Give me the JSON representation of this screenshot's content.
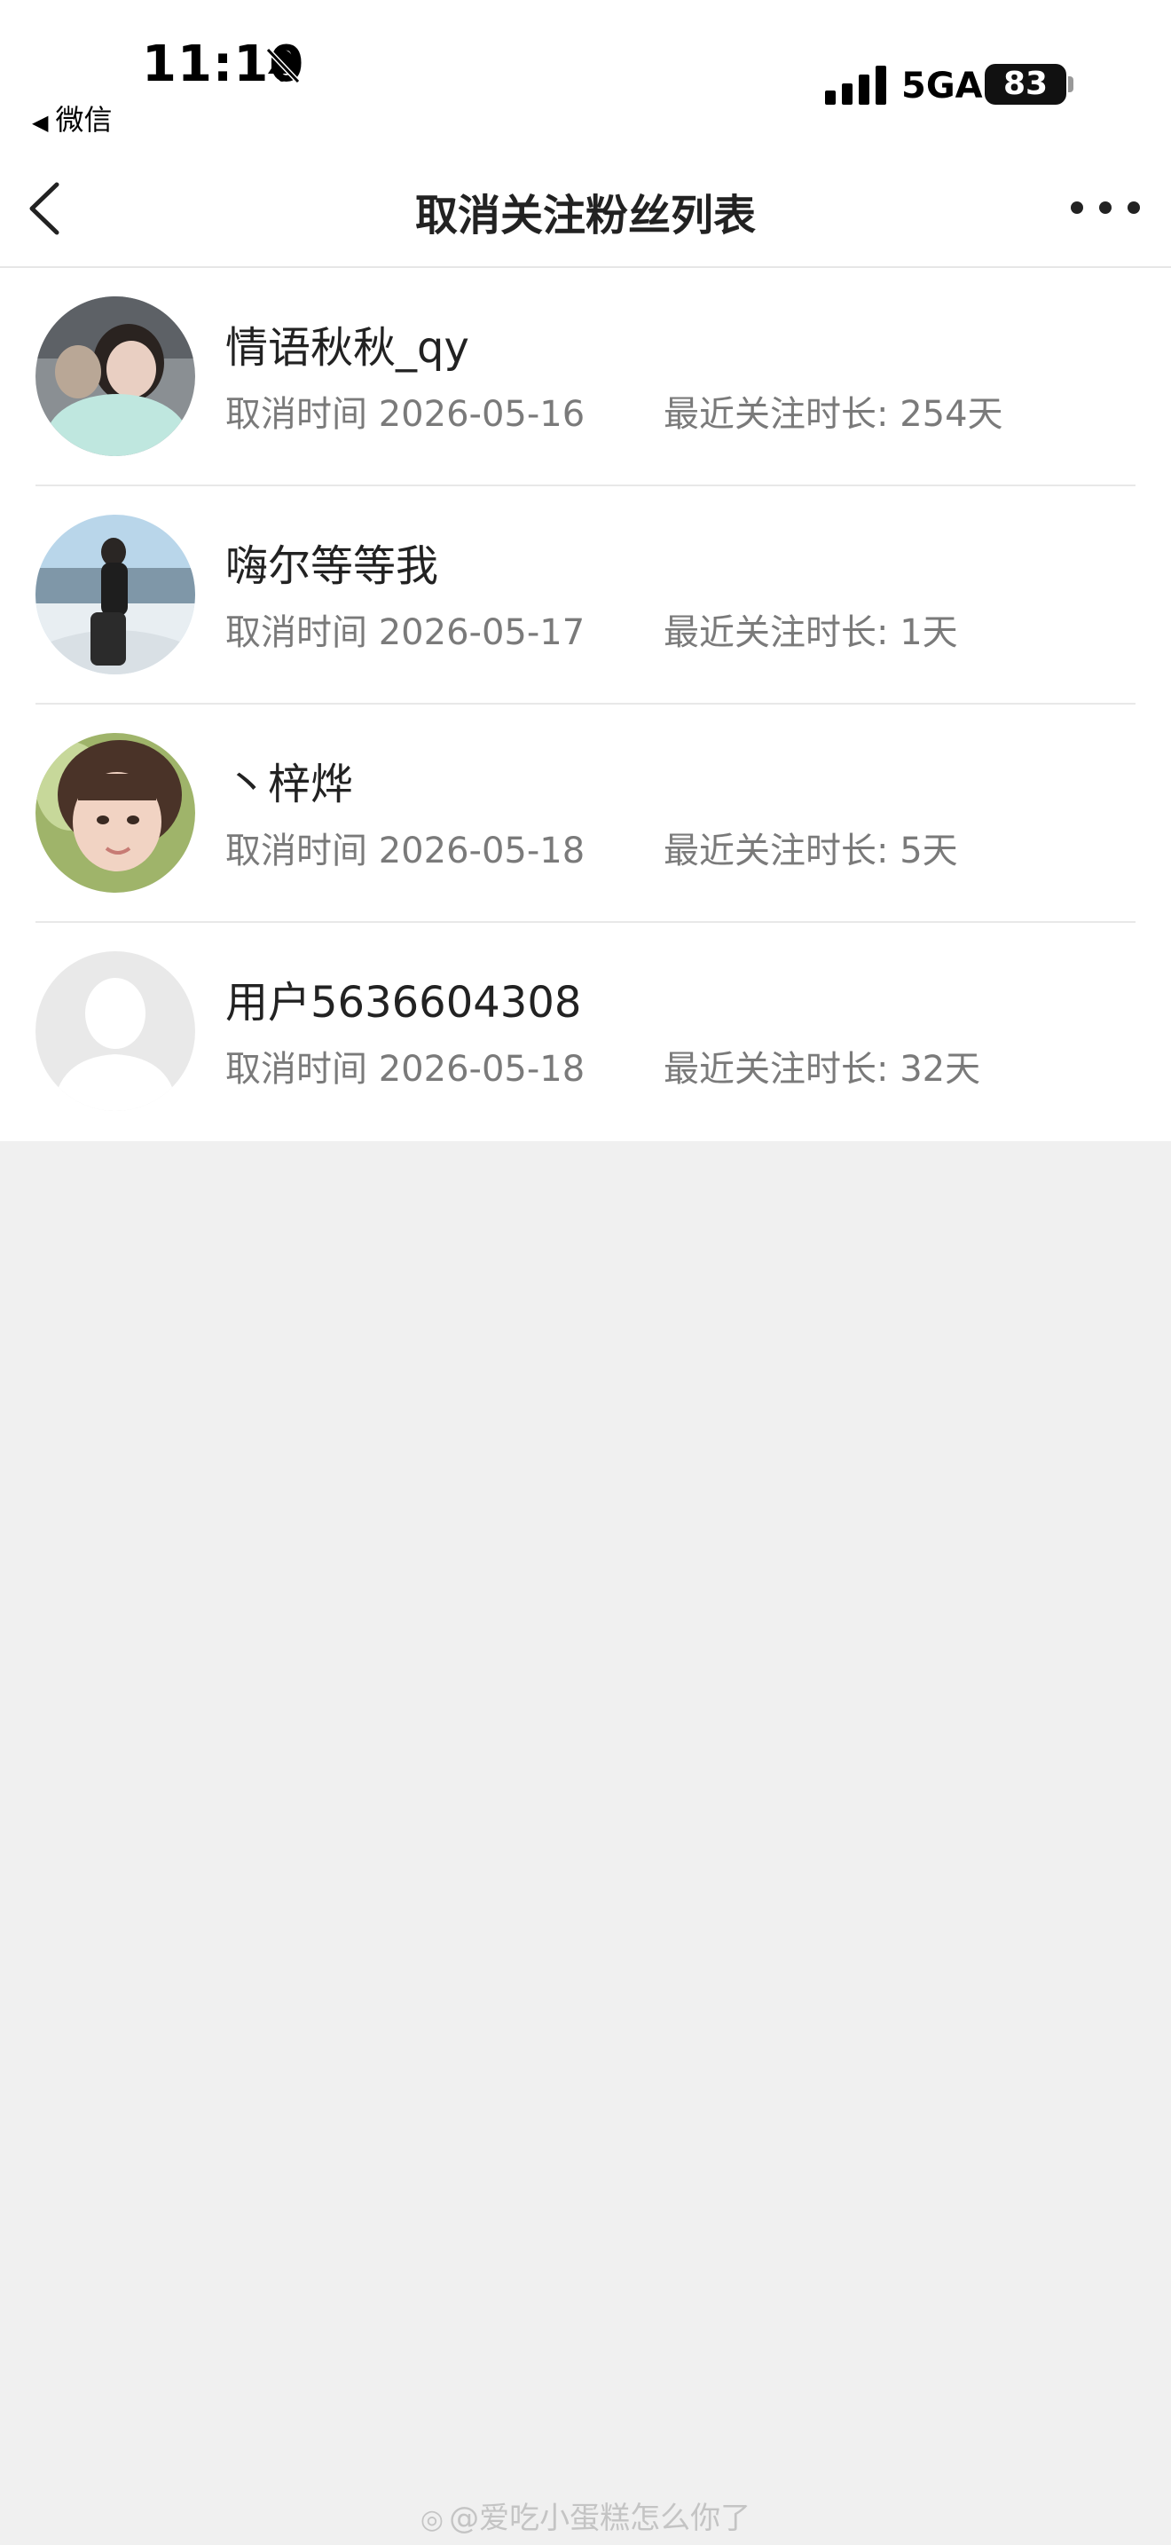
{
  "status_bar": {
    "time": "11:10",
    "back_app": "微信",
    "network": "5GA",
    "battery": "83"
  },
  "nav": {
    "title": "取消关注粉丝列表"
  },
  "fans": [
    {
      "name": "情语秋秋_qy",
      "cancel_label": "取消时间",
      "cancel_date": "2026-05-16",
      "duration_label": "最近关注时长:",
      "duration": "254天"
    },
    {
      "name": "嗨尔等等我",
      "cancel_label": "取消时间",
      "cancel_date": "2026-05-17",
      "duration_label": "最近关注时长:",
      "duration": "1天"
    },
    {
      "name": "丶梓烨",
      "cancel_label": "取消时间",
      "cancel_date": "2026-05-18",
      "duration_label": "最近关注时长:",
      "duration": "5天"
    },
    {
      "name": "用户5636604308",
      "cancel_label": "取消时间",
      "cancel_date": "2026-05-18",
      "duration_label": "最近关注时长:",
      "duration": "32天"
    }
  ],
  "watermark": "@爱吃小蛋糕怎么你了",
  "colors": {
    "background": "#f0f0f0",
    "surface": "#ffffff",
    "text": "#222222",
    "secondary_text": "#7a7a7a"
  }
}
